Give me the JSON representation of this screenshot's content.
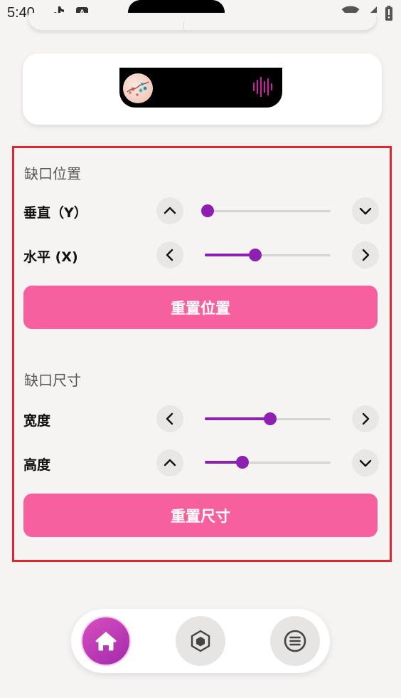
{
  "status_bar": {
    "time": "5:40",
    "font_badge": "A"
  },
  "preview": {
    "wave_color": "#c0289b"
  },
  "notch_position": {
    "title": "缺口位置",
    "vertical": {
      "label": "垂直（Y）",
      "value": 0.02
    },
    "horizontal": {
      "label": "水平 (X)",
      "value": 0.4
    },
    "reset_label": "重置位置"
  },
  "notch_size": {
    "title": "缺口尺寸",
    "width": {
      "label": "宽度",
      "value": 0.52
    },
    "height": {
      "label": "高度",
      "value": 0.3
    },
    "reset_label": "重置尺寸"
  },
  "colors": {
    "accent_purple": "#8e1fb0",
    "reset_pink": "#f6609e",
    "panel_border_red": "#e0262e"
  },
  "nav": {
    "items": [
      "home-icon",
      "cube-icon",
      "menu-icon"
    ],
    "active": "home-icon"
  }
}
